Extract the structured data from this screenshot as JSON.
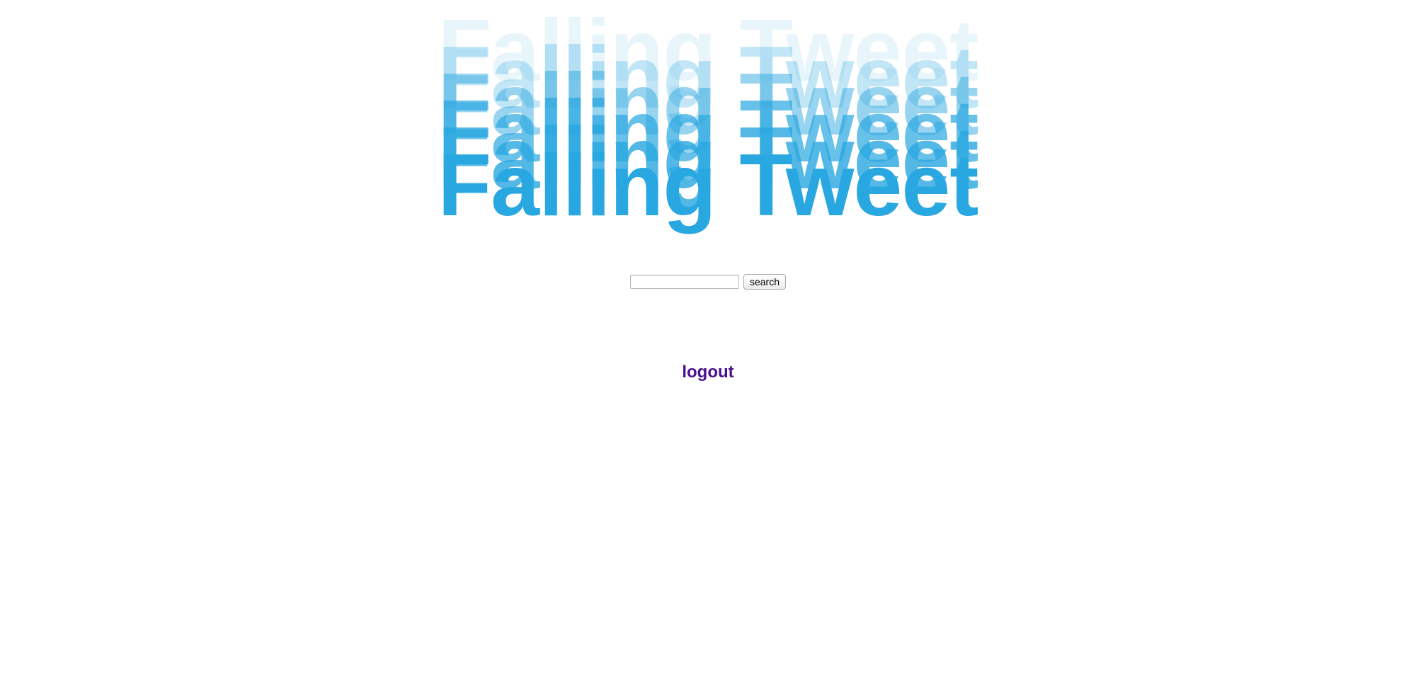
{
  "logo": {
    "text": "Falling Tweet",
    "color": "#29a7e1"
  },
  "search": {
    "value": "",
    "placeholder": "",
    "button_label": "search"
  },
  "logout": {
    "label": "logout",
    "color": "#4b0f8f"
  }
}
